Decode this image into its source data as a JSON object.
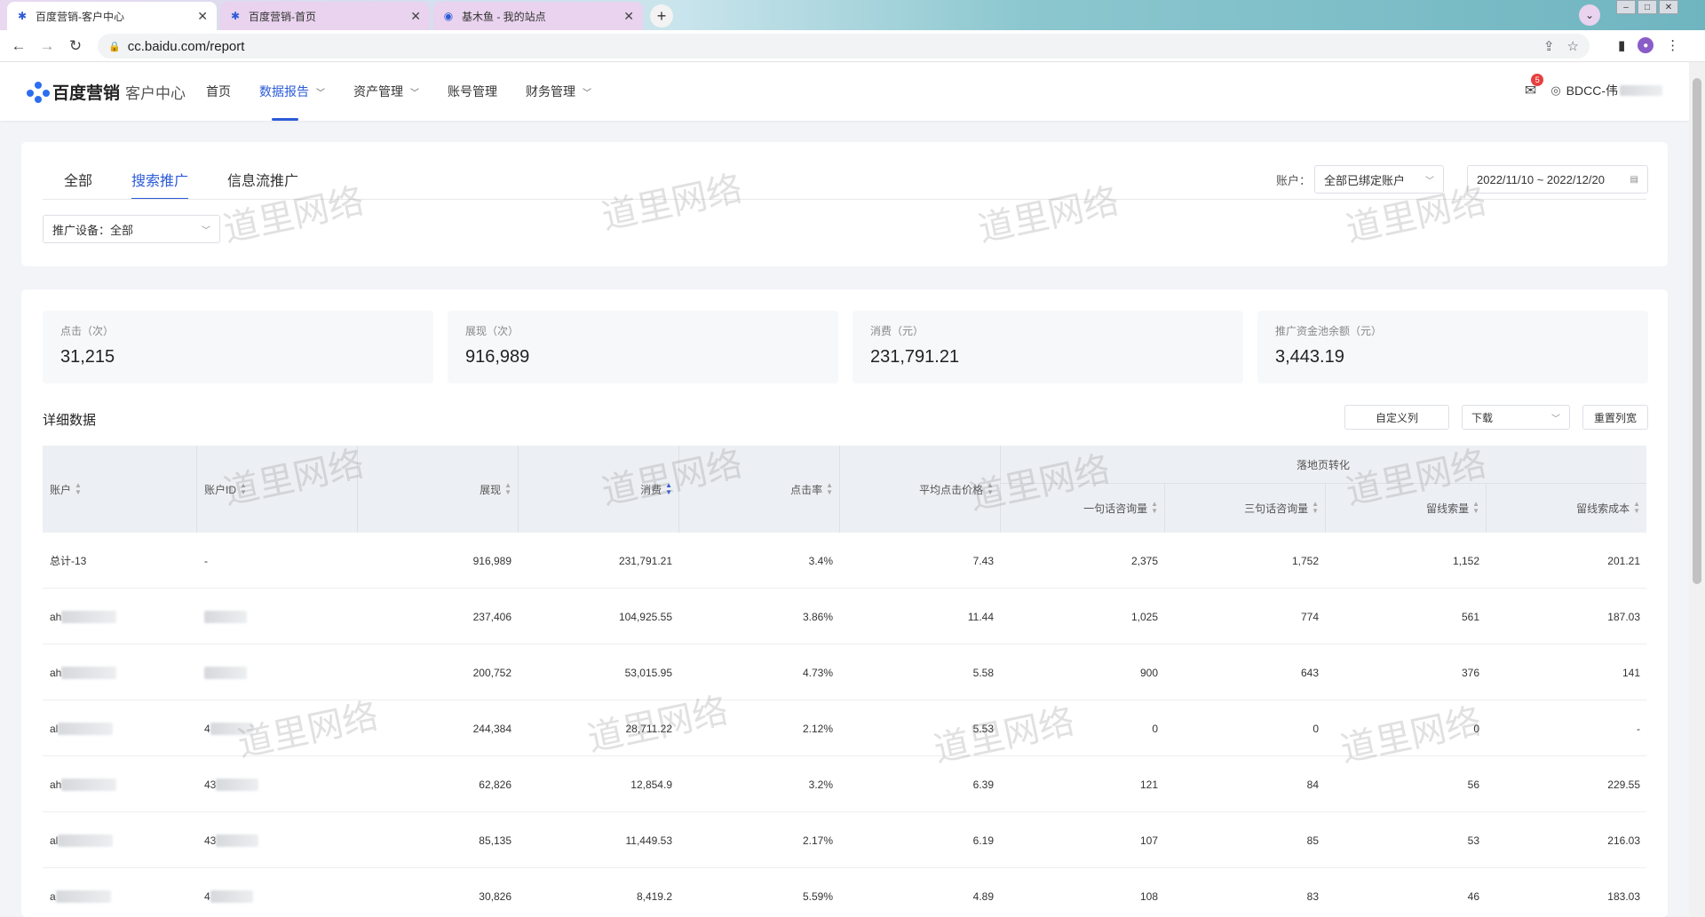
{
  "browser": {
    "tabs": [
      {
        "title": "百度营销-客户中心",
        "active": true
      },
      {
        "title": "百度营销-首页",
        "active": false
      },
      {
        "title": "基木鱼 - 我的站点",
        "active": false
      }
    ],
    "url": "cc.baidu.com/report"
  },
  "header": {
    "logo_text": "百度营销",
    "logo_sub": "客户中心",
    "nav": [
      {
        "label": "首页",
        "active": false,
        "dropdown": false
      },
      {
        "label": "数据报告",
        "active": true,
        "dropdown": true
      },
      {
        "label": "资产管理",
        "active": false,
        "dropdown": true
      },
      {
        "label": "账号管理",
        "active": false,
        "dropdown": false
      },
      {
        "label": "财务管理",
        "active": false,
        "dropdown": true
      }
    ],
    "notif_count": "5",
    "user": "BDCC-伟"
  },
  "filters": {
    "tabs": [
      "全部",
      "搜索推广",
      "信息流推广"
    ],
    "active_tab": 1,
    "account_label": "账户：",
    "account_value": "全部已绑定账户",
    "date_range": "2022/11/10 ~ 2022/12/20",
    "device": "推广设备：全部"
  },
  "metrics": [
    {
      "label": "点击（次）",
      "value": "31,215"
    },
    {
      "label": "展现（次）",
      "value": "916,989"
    },
    {
      "label": "消费（元）",
      "value": "231,791.21"
    },
    {
      "label": "推广资金池余额（元）",
      "value": "3,443.19"
    }
  ],
  "detail": {
    "title": "详细数据",
    "buttons": {
      "custom_cols": "自定义列",
      "download": "下载",
      "reset_width": "重置列宽"
    },
    "columns": {
      "account": "账户",
      "account_id": "账户ID",
      "impressions": "展现",
      "cost": "消费",
      "ctr": "点击率",
      "avg_cpc": "平均点击价格",
      "landing_group": "落地页转化",
      "one_consult": "一句话咨询量",
      "three_consult": "三句话咨询量",
      "leads": "留线索量",
      "lead_cost": "留线索成本"
    },
    "rows": [
      {
        "account": "总计-13",
        "account_id": "-",
        "impressions": "916,989",
        "cost": "231,791.21",
        "ctr": "3.4%",
        "avg_cpc": "7.43",
        "one_consult": "2,375",
        "three_consult": "1,752",
        "leads": "1,152",
        "lead_cost": "201.21"
      },
      {
        "account": "ah",
        "account_id": "",
        "impressions": "237,406",
        "cost": "104,925.55",
        "ctr": "3.86%",
        "avg_cpc": "11.44",
        "one_consult": "1,025",
        "three_consult": "774",
        "leads": "561",
        "lead_cost": "187.03"
      },
      {
        "account": "ah",
        "account_id": "",
        "impressions": "200,752",
        "cost": "53,015.95",
        "ctr": "4.73%",
        "avg_cpc": "5.58",
        "one_consult": "900",
        "three_consult": "643",
        "leads": "376",
        "lead_cost": "141"
      },
      {
        "account": "al",
        "account_id": "4",
        "impressions": "244,384",
        "cost": "28,711.22",
        "ctr": "2.12%",
        "avg_cpc": "5.53",
        "one_consult": "0",
        "three_consult": "0",
        "leads": "0",
        "lead_cost": "-"
      },
      {
        "account": "ah",
        "account_id": "43",
        "impressions": "62,826",
        "cost": "12,854.9",
        "ctr": "3.2%",
        "avg_cpc": "6.39",
        "one_consult": "121",
        "three_consult": "84",
        "leads": "56",
        "lead_cost": "229.55"
      },
      {
        "account": "al",
        "account_id": "43",
        "impressions": "85,135",
        "cost": "11,449.53",
        "ctr": "2.17%",
        "avg_cpc": "6.19",
        "one_consult": "107",
        "three_consult": "85",
        "leads": "53",
        "lead_cost": "216.03"
      },
      {
        "account": "a",
        "account_id": "4",
        "impressions": "30,826",
        "cost": "8,419.2",
        "ctr": "5.59%",
        "avg_cpc": "4.89",
        "one_consult": "108",
        "three_consult": "83",
        "leads": "46",
        "lead_cost": "183.03"
      }
    ]
  },
  "watermark": "道里网络",
  "colors": {
    "accent": "#2b5bd7",
    "badge": "#e54040",
    "header_bg": "#eceff3"
  }
}
